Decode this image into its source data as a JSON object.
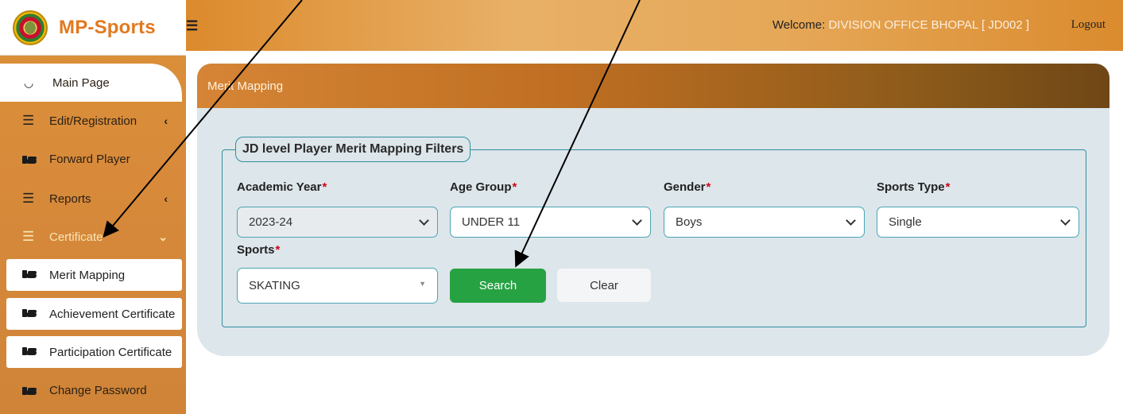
{
  "app": {
    "brand_name": "MP-Sports",
    "brand_color": "#e2791f",
    "accent_color": "#d98a36"
  },
  "topbar": {
    "menu_icon": "hamburger-icon",
    "welcome_label": "Welcome: ",
    "welcome_user": "DIVISION OFFICE BHOPAL [ JD002 ]",
    "logout_label": "Logout"
  },
  "sidebar": {
    "items": [
      {
        "label": "Main Page",
        "icon": "dashboard-icon"
      },
      {
        "label": "Edit/Registration",
        "icon": "list-icon",
        "expand_icon": "chevron-left-icon"
      },
      {
        "label": "Forward Player",
        "icon": "hand-point-icon"
      },
      {
        "label": "Reports",
        "icon": "list-icon",
        "expand_icon": "chevron-left-icon"
      },
      {
        "label": "Certificate",
        "icon": "list-icon",
        "expand_icon": "chevron-down-icon",
        "expanded": true
      }
    ],
    "sub_items": [
      {
        "label": "Merit Mapping",
        "icon": "hand-point-icon"
      },
      {
        "label": "Achievement Certificate",
        "icon": "hand-point-icon"
      },
      {
        "label": "Participation Certificate",
        "icon": "hand-point-icon"
      }
    ],
    "footer_item": {
      "label": "Change Password",
      "icon": "hand-point-icon"
    }
  },
  "page": {
    "title": "Merit Mapping",
    "filters_legend": "JD level Player Merit Mapping Filters",
    "required_mark": "*",
    "fields": {
      "academic_year": {
        "label": "Academic Year",
        "value": "2023-24",
        "disabled": true
      },
      "age_group": {
        "label": "Age Group",
        "value": "UNDER 11"
      },
      "gender": {
        "label": "Gender",
        "value": "Boys"
      },
      "sports_type": {
        "label": "Sports Type",
        "value": "Single"
      },
      "sports": {
        "label": "Sports",
        "value": "SKATING"
      }
    },
    "search_button": "Search",
    "clear_button": "Clear",
    "search_button_color": "#27a243"
  }
}
